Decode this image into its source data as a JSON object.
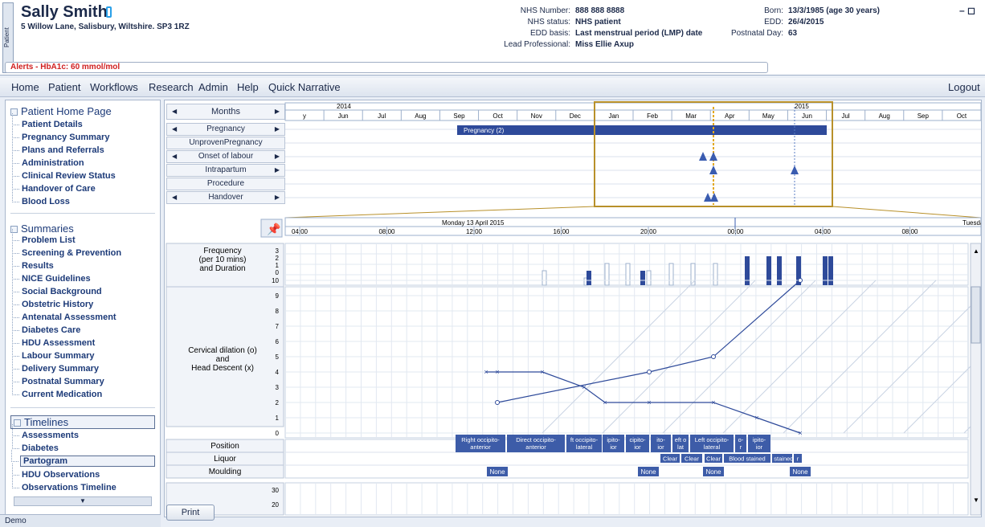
{
  "patient": {
    "tab_label": "Patient",
    "name": "Sally Smith",
    "address": "5 Willow Lane, Salisbury, Wiltshire. SP3 1RZ",
    "alert": "Alerts - HbA1c: 60 mmol/mol",
    "nhs_number_label": "NHS Number:",
    "nhs_number": "888 888 8888",
    "nhs_status_label": "NHS status:",
    "nhs_status": "NHS patient",
    "edd_basis_label": "EDD basis:",
    "edd_basis": "Last menstrual period (LMP) date",
    "lead_label": "Lead Professional:",
    "lead": "Miss Ellie Axup",
    "born_label": "Born:",
    "born": "13/3/1985 (age 30 years)",
    "edd_label": "EDD:",
    "edd": "26/4/2015",
    "postnatal_label": "Postnatal Day:",
    "postnatal": "63"
  },
  "menu": {
    "home": "Home",
    "patient": "Patient",
    "workflows": "Workflows",
    "research": "Research",
    "admin": "Admin",
    "help": "Help",
    "quick": "Quick Narrative",
    "logout": "Logout"
  },
  "sidebar": {
    "home_title": "Patient Home Page",
    "home_items": [
      "Patient Details",
      "Pregnancy Summary",
      "Plans and Referrals",
      "Administration",
      "Clinical Review Status",
      "Handover of Care",
      "Blood Loss"
    ],
    "summaries_title": "Summaries",
    "summaries_items": [
      "Problem List",
      "Screening & Prevention",
      "Results",
      "NICE Guidelines",
      "Social Background",
      "Obstetric History",
      "Antenatal Assessment",
      "Diabetes Care",
      "HDU Assessment",
      "Labour Summary",
      "Delivery Summary",
      "Postnatal Summary",
      "Current Medication"
    ],
    "timelines_title": "Timelines",
    "timelines_items": [
      "Assessments",
      "Diabetes",
      "Partogram",
      "HDU Observations",
      "Observations Timeline"
    ],
    "footer": "Demo"
  },
  "timeline": {
    "rows": [
      "Months",
      "Pregnancy",
      "UnprovenPregnancy",
      "Onset of labour",
      "Intrapartum",
      "Procedure",
      "Handover"
    ],
    "years": [
      "2014",
      "2015"
    ],
    "months": [
      "y",
      "Jun",
      "Jul",
      "Aug",
      "Sep",
      "Oct",
      "Nov",
      "Dec",
      "Jan",
      "Feb",
      "Mar",
      "Apr",
      "May",
      "Jun",
      "Jul",
      "Aug",
      "Sep",
      "Oct"
    ],
    "pregnancy_bar": "Pregnancy (2)"
  },
  "detail": {
    "date_label": "Monday 13 April 2015",
    "next_day": "Tuesda",
    "times": [
      "04:00",
      "08:00",
      "12:00",
      "16:00",
      "20:00",
      "00:00",
      "04:00",
      "08:00"
    ]
  },
  "partogram": {
    "freq_label": "Frequency\n(per 10 mins)\nand Duration",
    "freq_ticks": [
      "3",
      "2",
      "1",
      "0"
    ],
    "dilation_label": "Cervical dilation (o)\nand\nHead Descent (x)",
    "y_ticks": [
      "10",
      "9",
      "8",
      "7",
      "6",
      "5",
      "4",
      "3",
      "2",
      "1",
      "0"
    ],
    "position_label": "Position",
    "liquor_label": "Liquor",
    "moulding_label": "Moulding",
    "bottom_ticks": [
      "30",
      "20"
    ],
    "positions": [
      "Right occipito-\nanterior",
      "Direct occipito-\nanterior",
      "ft occipito-\nlateral",
      "ipito-\nior",
      "cipito-\nior",
      "ito-\nior",
      "eft o\nlat",
      "Left occipito-\nlateral",
      "o-\nr",
      "ipito-\nior"
    ],
    "liquor": [
      "Clear",
      "Clear",
      "Clear",
      "Blood stained",
      "l stained",
      "r"
    ],
    "moulding": [
      "None",
      "None",
      "None",
      "None"
    ],
    "dilation_series": [
      2,
      4,
      5,
      10
    ],
    "descent_series": [
      4,
      4,
      4,
      3,
      2,
      2,
      2,
      1,
      0
    ]
  },
  "print_label": "Print"
}
